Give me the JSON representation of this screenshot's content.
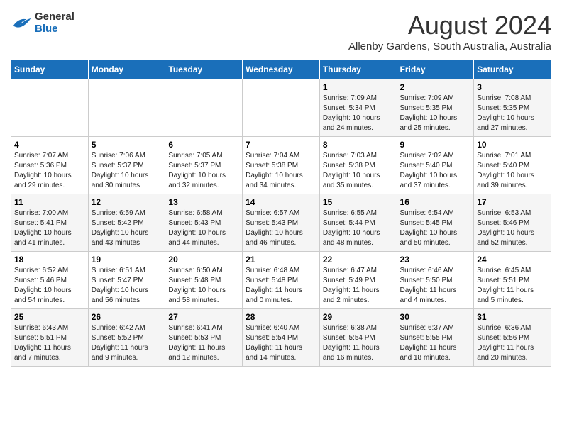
{
  "header": {
    "logo_line1": "General",
    "logo_line2": "Blue",
    "main_title": "August 2024",
    "subtitle": "Allenby Gardens, South Australia, Australia"
  },
  "weekdays": [
    "Sunday",
    "Monday",
    "Tuesday",
    "Wednesday",
    "Thursday",
    "Friday",
    "Saturday"
  ],
  "weeks": [
    [
      {
        "day": "",
        "detail": ""
      },
      {
        "day": "",
        "detail": ""
      },
      {
        "day": "",
        "detail": ""
      },
      {
        "day": "",
        "detail": ""
      },
      {
        "day": "1",
        "detail": "Sunrise: 7:09 AM\nSunset: 5:34 PM\nDaylight: 10 hours\nand 24 minutes."
      },
      {
        "day": "2",
        "detail": "Sunrise: 7:09 AM\nSunset: 5:35 PM\nDaylight: 10 hours\nand 25 minutes."
      },
      {
        "day": "3",
        "detail": "Sunrise: 7:08 AM\nSunset: 5:35 PM\nDaylight: 10 hours\nand 27 minutes."
      }
    ],
    [
      {
        "day": "4",
        "detail": "Sunrise: 7:07 AM\nSunset: 5:36 PM\nDaylight: 10 hours\nand 29 minutes."
      },
      {
        "day": "5",
        "detail": "Sunrise: 7:06 AM\nSunset: 5:37 PM\nDaylight: 10 hours\nand 30 minutes."
      },
      {
        "day": "6",
        "detail": "Sunrise: 7:05 AM\nSunset: 5:37 PM\nDaylight: 10 hours\nand 32 minutes."
      },
      {
        "day": "7",
        "detail": "Sunrise: 7:04 AM\nSunset: 5:38 PM\nDaylight: 10 hours\nand 34 minutes."
      },
      {
        "day": "8",
        "detail": "Sunrise: 7:03 AM\nSunset: 5:38 PM\nDaylight: 10 hours\nand 35 minutes."
      },
      {
        "day": "9",
        "detail": "Sunrise: 7:02 AM\nSunset: 5:40 PM\nDaylight: 10 hours\nand 37 minutes."
      },
      {
        "day": "10",
        "detail": "Sunrise: 7:01 AM\nSunset: 5:40 PM\nDaylight: 10 hours\nand 39 minutes."
      }
    ],
    [
      {
        "day": "11",
        "detail": "Sunrise: 7:00 AM\nSunset: 5:41 PM\nDaylight: 10 hours\nand 41 minutes."
      },
      {
        "day": "12",
        "detail": "Sunrise: 6:59 AM\nSunset: 5:42 PM\nDaylight: 10 hours\nand 43 minutes."
      },
      {
        "day": "13",
        "detail": "Sunrise: 6:58 AM\nSunset: 5:43 PM\nDaylight: 10 hours\nand 44 minutes."
      },
      {
        "day": "14",
        "detail": "Sunrise: 6:57 AM\nSunset: 5:43 PM\nDaylight: 10 hours\nand 46 minutes."
      },
      {
        "day": "15",
        "detail": "Sunrise: 6:55 AM\nSunset: 5:44 PM\nDaylight: 10 hours\nand 48 minutes."
      },
      {
        "day": "16",
        "detail": "Sunrise: 6:54 AM\nSunset: 5:45 PM\nDaylight: 10 hours\nand 50 minutes."
      },
      {
        "day": "17",
        "detail": "Sunrise: 6:53 AM\nSunset: 5:46 PM\nDaylight: 10 hours\nand 52 minutes."
      }
    ],
    [
      {
        "day": "18",
        "detail": "Sunrise: 6:52 AM\nSunset: 5:46 PM\nDaylight: 10 hours\nand 54 minutes."
      },
      {
        "day": "19",
        "detail": "Sunrise: 6:51 AM\nSunset: 5:47 PM\nDaylight: 10 hours\nand 56 minutes."
      },
      {
        "day": "20",
        "detail": "Sunrise: 6:50 AM\nSunset: 5:48 PM\nDaylight: 10 hours\nand 58 minutes."
      },
      {
        "day": "21",
        "detail": "Sunrise: 6:48 AM\nSunset: 5:48 PM\nDaylight: 11 hours\nand 0 minutes."
      },
      {
        "day": "22",
        "detail": "Sunrise: 6:47 AM\nSunset: 5:49 PM\nDaylight: 11 hours\nand 2 minutes."
      },
      {
        "day": "23",
        "detail": "Sunrise: 6:46 AM\nSunset: 5:50 PM\nDaylight: 11 hours\nand 4 minutes."
      },
      {
        "day": "24",
        "detail": "Sunrise: 6:45 AM\nSunset: 5:51 PM\nDaylight: 11 hours\nand 5 minutes."
      }
    ],
    [
      {
        "day": "25",
        "detail": "Sunrise: 6:43 AM\nSunset: 5:51 PM\nDaylight: 11 hours\nand 7 minutes."
      },
      {
        "day": "26",
        "detail": "Sunrise: 6:42 AM\nSunset: 5:52 PM\nDaylight: 11 hours\nand 9 minutes."
      },
      {
        "day": "27",
        "detail": "Sunrise: 6:41 AM\nSunset: 5:53 PM\nDaylight: 11 hours\nand 12 minutes."
      },
      {
        "day": "28",
        "detail": "Sunrise: 6:40 AM\nSunset: 5:54 PM\nDaylight: 11 hours\nand 14 minutes."
      },
      {
        "day": "29",
        "detail": "Sunrise: 6:38 AM\nSunset: 5:54 PM\nDaylight: 11 hours\nand 16 minutes."
      },
      {
        "day": "30",
        "detail": "Sunrise: 6:37 AM\nSunset: 5:55 PM\nDaylight: 11 hours\nand 18 minutes."
      },
      {
        "day": "31",
        "detail": "Sunrise: 6:36 AM\nSunset: 5:56 PM\nDaylight: 11 hours\nand 20 minutes."
      }
    ]
  ]
}
